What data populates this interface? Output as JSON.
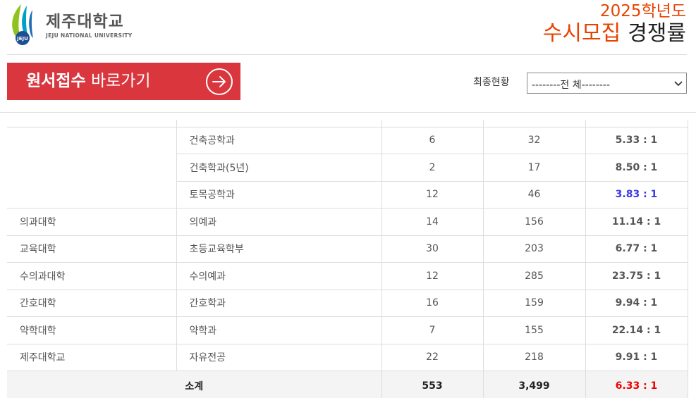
{
  "header": {
    "logo_name": "제주대학교",
    "logo_sub": "JEJU NATIONAL UNIVERSITY",
    "logo_badge": "JEJU",
    "year": "2025학년도",
    "title_red": "수시모집",
    "title_black": "경쟁률"
  },
  "apply_button": {
    "bold": "원서접수",
    "rest": "바로가기"
  },
  "filter": {
    "label": "최종현황",
    "selected": "--------전 체--------"
  },
  "colors": {
    "brand_red": "#d9363e",
    "title_orange": "#e84200",
    "ratio_red": "#e00000",
    "ratio_blue": "#3a3ae6"
  },
  "table": {
    "group_rows": [
      {
        "dept": "건축공학과",
        "quota": "6",
        "applicants": "32",
        "ratio": "5.33 : 1"
      },
      {
        "dept": "건축학과(5년)",
        "quota": "2",
        "applicants": "17",
        "ratio": "8.50 : 1"
      },
      {
        "dept": "토목공학과",
        "quota": "12",
        "applicants": "46",
        "ratio": "3.83 : 1"
      }
    ],
    "rows": [
      {
        "college": "의과대학",
        "dept": "의예과",
        "quota": "14",
        "applicants": "156",
        "ratio": "11.14 : 1"
      },
      {
        "college": "교육대학",
        "dept": "초등교육학부",
        "quota": "30",
        "applicants": "203",
        "ratio": "6.77 : 1"
      },
      {
        "college": "수의과대학",
        "dept": "수의예과",
        "quota": "12",
        "applicants": "285",
        "ratio": "23.75 : 1"
      },
      {
        "college": "간호대학",
        "dept": "간호학과",
        "quota": "16",
        "applicants": "159",
        "ratio": "9.94 : 1"
      },
      {
        "college": "약학대학",
        "dept": "약학과",
        "quota": "7",
        "applicants": "155",
        "ratio": "22.14 : 1"
      },
      {
        "college": "제주대학교",
        "dept": "자유전공",
        "quota": "22",
        "applicants": "218",
        "ratio": "9.91 : 1"
      }
    ],
    "total": {
      "label": "소계",
      "quota": "553",
      "applicants": "3,499",
      "ratio": "6.33 : 1"
    }
  }
}
